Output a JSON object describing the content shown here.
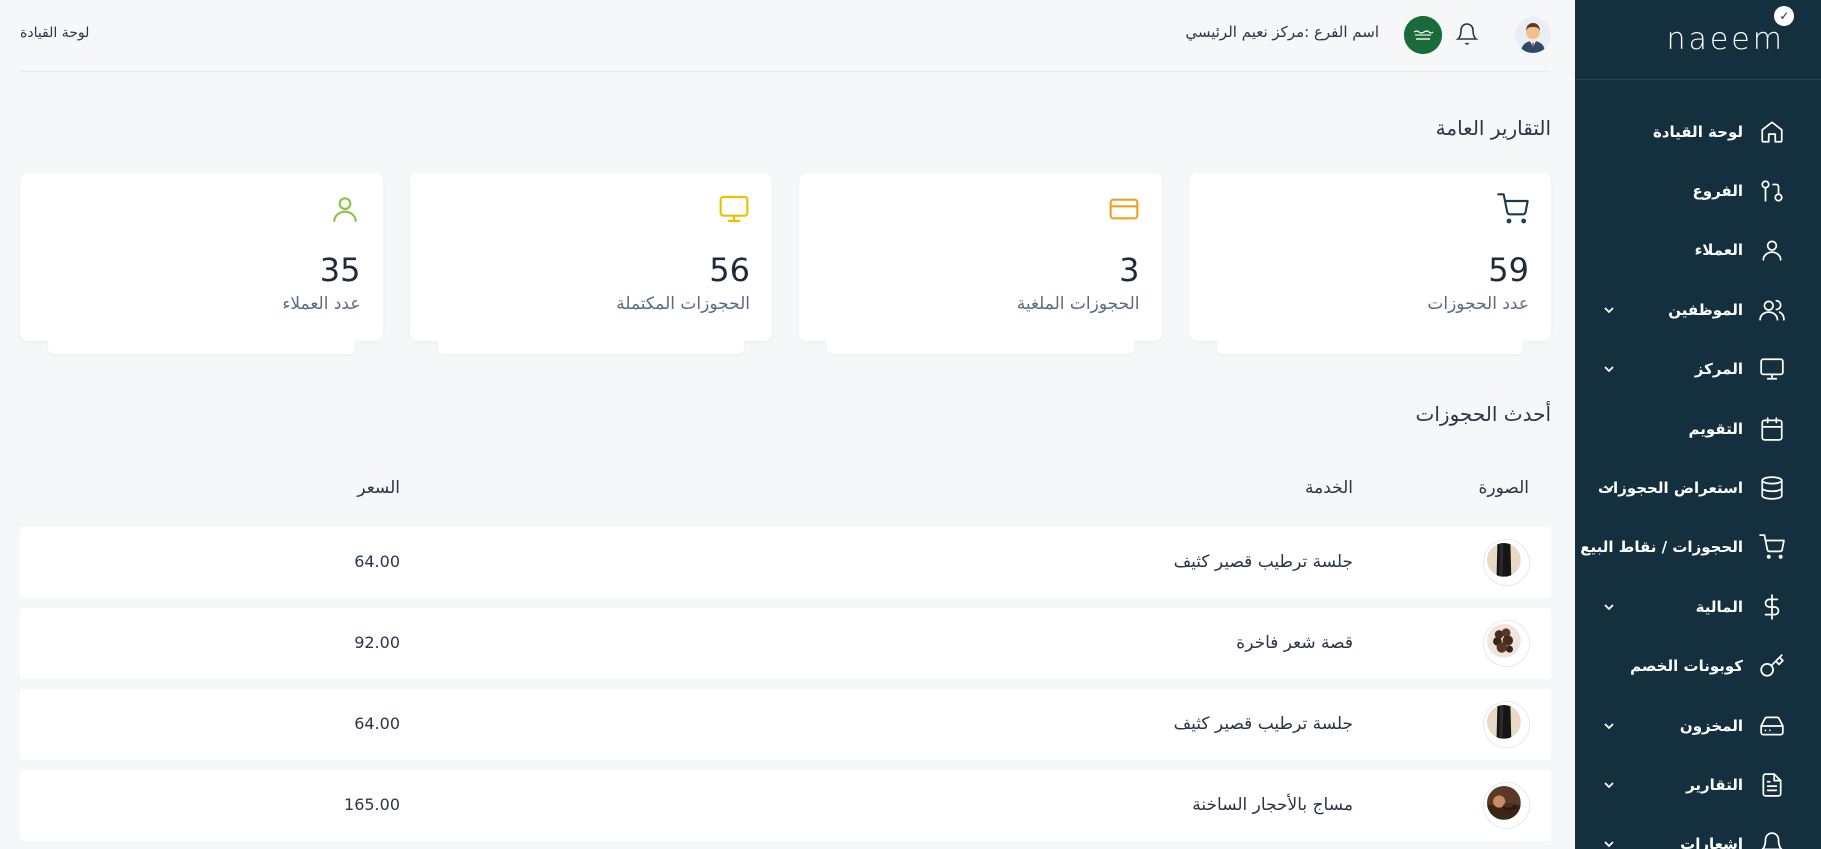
{
  "sidebar": {
    "logo": "naeem",
    "items": [
      {
        "label": "لوحة القيادة",
        "icon": "home-icon",
        "chevron": false
      },
      {
        "label": "الفروع",
        "icon": "branches-icon",
        "chevron": false
      },
      {
        "label": "العملاء",
        "icon": "user-icon",
        "chevron": false
      },
      {
        "label": "الموظفين",
        "icon": "users-icon",
        "chevron": true
      },
      {
        "label": "المركز",
        "icon": "monitor-icon",
        "chevron": true
      },
      {
        "label": "التقويم",
        "icon": "calendar-icon",
        "chevron": false
      },
      {
        "label": "استعراض الحجوزات",
        "icon": "database-icon",
        "chevron": true
      },
      {
        "label": "الحجوزات / نقاط البيع",
        "icon": "cart-icon",
        "chevron": false
      },
      {
        "label": "المالية",
        "icon": "dollar-icon",
        "chevron": true
      },
      {
        "label": "كوبونات الخصم",
        "icon": "key-icon",
        "chevron": false
      },
      {
        "label": "المخزون",
        "icon": "hard-drive-icon",
        "chevron": true
      },
      {
        "label": "التقارير",
        "icon": "file-text-icon",
        "chevron": true
      },
      {
        "label": "إشعارات",
        "icon": "bell-icon",
        "chevron": true
      }
    ]
  },
  "header": {
    "branch_label": "اسم الفرع :مركز نعيم الرئيسي",
    "breadcrumb": "لوحة القيادة"
  },
  "reports": {
    "title": "التقارير العامة",
    "cards": [
      {
        "value": "59",
        "label": "عدد الحجوزات",
        "icon": "cart-icon",
        "color": "#1f3a4d"
      },
      {
        "value": "3",
        "label": "الحجوزات الملغية",
        "icon": "credit-card-icon",
        "color": "#f0a020"
      },
      {
        "value": "56",
        "label": "الحجوزات المكتملة",
        "icon": "monitor-icon",
        "color": "#e8c100"
      },
      {
        "value": "35",
        "label": "عدد العملاء",
        "icon": "user-icon",
        "color": "#8bc34a"
      }
    ]
  },
  "bookings": {
    "title": "أحدث الحجوزات",
    "columns": {
      "image": "الصورة",
      "service": "الخدمة",
      "price": "السعر"
    },
    "rows": [
      {
        "service": "جلسة ترطيب قصير كثيف",
        "price": "64.00",
        "thumb": "hair-straight"
      },
      {
        "service": "قصة شعر فاخرة",
        "price": "92.00",
        "thumb": "hair-curly"
      },
      {
        "service": "جلسة ترطيب قصير كثيف",
        "price": "64.00",
        "thumb": "hair-straight"
      },
      {
        "service": "مساج بالأحجار الساخنة",
        "price": "165.00",
        "thumb": "massage"
      }
    ]
  }
}
